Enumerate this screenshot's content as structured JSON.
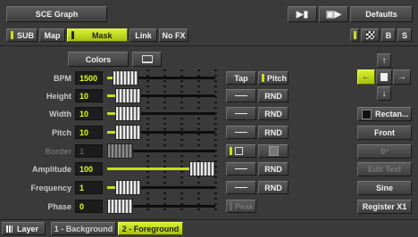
{
  "header": {
    "title": "SCE Graph",
    "defaults_label": "Defaults"
  },
  "tabs": {
    "sub": "SUB",
    "map": "Map",
    "mask": "Mask",
    "link": "Link",
    "nofx": "No FX",
    "b": "B",
    "s": "S"
  },
  "controls": {
    "colors_label": "Colors"
  },
  "params": [
    {
      "label": "BPM",
      "value": "1500",
      "level": 0.06
    },
    {
      "label": "Height",
      "value": "10",
      "level": 0.1
    },
    {
      "label": "Width",
      "value": "10",
      "level": 0.1
    },
    {
      "label": "Pitch",
      "value": "10",
      "level": 0.1
    },
    {
      "label": "Border",
      "value": "1",
      "level": 0.0
    },
    {
      "label": "Amplitude",
      "value": "100",
      "level": 1.0
    },
    {
      "label": "Frequency",
      "value": "1",
      "level": 0.1
    },
    {
      "label": "Phase",
      "value": "0",
      "level": 0.0
    }
  ],
  "side_buttons": {
    "tap": "Tap",
    "pitch": "Pitch",
    "rnd": "RND",
    "peak": "Peak"
  },
  "right_panel": {
    "shape": "Rectan...",
    "front": "Front",
    "angle": "0°",
    "edit_text": "Edit Text",
    "sine": "Sine",
    "register": "Register X1"
  },
  "footer": {
    "layer_label": "Layer",
    "tab_background": "1 - Background",
    "tab_foreground": "2 - Foreground"
  },
  "colors": {
    "accent": "#c8e020",
    "value_text": "#d9ff20",
    "panel_bg": "#3a3a3a"
  }
}
